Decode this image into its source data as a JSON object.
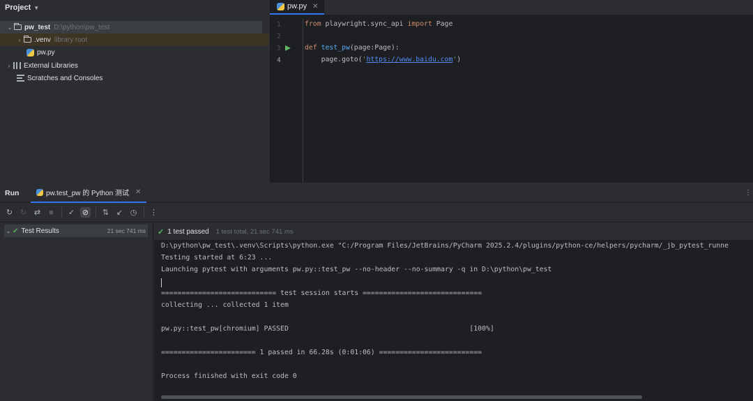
{
  "project": {
    "title": "Project",
    "root": {
      "name": "pw_test",
      "path": "D:\\python\\pw_test"
    },
    "venv": {
      "name": ".venv",
      "hint": "library root"
    },
    "file": "pw.py",
    "external": "External Libraries",
    "scratches": "Scratches and Consoles"
  },
  "editor": {
    "tab": "pw.py",
    "line_numbers": [
      "1",
      "2",
      "3",
      "4"
    ],
    "line1": {
      "kw1": "from",
      "mod": " playwright.sync_api ",
      "kw2": "import",
      "rest": " Page"
    },
    "line3": {
      "kw": "def",
      "fn": "test_pw",
      "rest": "(page:Page):"
    },
    "line4": {
      "pre": "    page.goto(",
      "q1": "'",
      "url": "https://www.baidu.com",
      "q2": "'",
      "post": ")"
    }
  },
  "run": {
    "title": "Run",
    "tab": "pw.test_pw 的 Python 测试",
    "results_label": "Test Results",
    "results_time": "21 sec 741 ms",
    "status": "1 test passed",
    "status_detail": "1 test total, 21 sec 741 ms",
    "console": [
      "D:\\python\\pw_test\\.venv\\Scripts\\python.exe \"C:/Program Files/JetBrains/PyCharm 2025.2.4/plugins/python-ce/helpers/pycharm/_jb_pytest_runne",
      "Testing started at 6:23 ...",
      "Launching pytest with arguments pw.py::test_pw --no-header --no-summary -q in D:\\python\\pw_test",
      "",
      "============================ test session starts =============================",
      "collecting ... collected 1 item",
      "",
      "pw.py::test_pw[chromium] PASSED                                            [100%]",
      "",
      "======================= 1 passed in 66.28s (0:01:06) =========================",
      "",
      "Process finished with exit code 0"
    ]
  },
  "colors": {
    "accent": "#3574f0",
    "pass": "#5fb865",
    "keyword": "#cf8e6d",
    "function": "#56a8f5",
    "string": "#6aab73"
  }
}
